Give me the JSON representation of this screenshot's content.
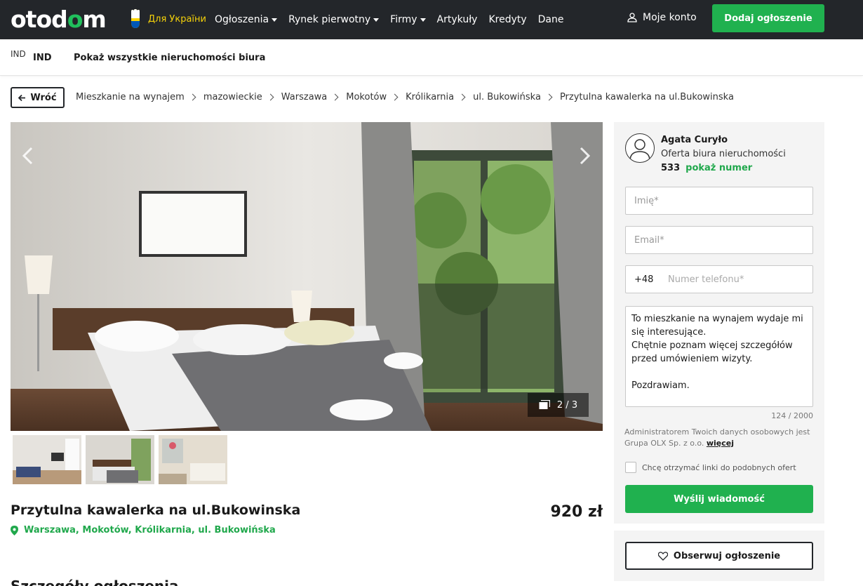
{
  "header": {
    "logo_parts": [
      "otod",
      "o",
      "m"
    ],
    "ukraine_label": "Для України",
    "nav": [
      {
        "label": "Ogłoszenia",
        "dropdown": true
      },
      {
        "label": "Rynek pierwotny",
        "dropdown": true
      },
      {
        "label": "Firmy",
        "dropdown": true
      },
      {
        "label": "Artykuły",
        "dropdown": false
      },
      {
        "label": "Kredyty",
        "dropdown": false
      },
      {
        "label": "Dane",
        "dropdown": false
      }
    ],
    "account_label": "Moje konto",
    "add_label": "Dodaj ogłoszenie"
  },
  "agency": {
    "logo_text": "IND",
    "name": "IND",
    "all_listings_label": "Pokaż wszystkie nieruchomości biura"
  },
  "breadcrumb": {
    "back_label": "Wróć",
    "items": [
      "Mieszkanie na wynajem",
      "mazowieckie",
      "Warszawa",
      "Mokotów",
      "Królikarnia",
      "ul. Bukowińska",
      "Przytulna kawalerka na ul.Bukowinska"
    ]
  },
  "gallery": {
    "counter": "2 / 3",
    "current": 2,
    "total": 3
  },
  "listing": {
    "title": "Przytulna kawalerka na ul.Bukowinska",
    "price": "920 zł",
    "location": "Warszawa, Mokotów, Królikarnia, ul. Bukowińska",
    "next_section_title": "Szczegóły ogłoszenia"
  },
  "contact": {
    "agent_name": "Agata Curyło",
    "agent_type": "Oferta biura nieruchomości",
    "phone_partial": "533",
    "show_number_label": "pokaż numer",
    "name_placeholder": "Imię*",
    "email_placeholder": "Email*",
    "phone_prefix": "+48",
    "phone_placeholder": "Numer telefonu*",
    "message": "To mieszkanie na wynajem wydaje mi się interesujące.\nChętnie poznam więcej szczegółów przed umówieniem wizyty.\n\nPozdrawiam.",
    "char_counter": "124 / 2000",
    "gdpr_text": "Administratorem Twoich danych osobowych jest Grupa OLX Sp. z o.o.",
    "gdpr_more": "więcej",
    "similar_checkbox_label": "Chcę otrzymać linki do podobnych ofert",
    "send_label": "Wyślij wiadomość",
    "watch_label": "Obserwuj ogłoszenie"
  },
  "colors": {
    "brand_green": "#20b14f",
    "nav_bg": "#23262a",
    "link_green": "#20a84c"
  }
}
